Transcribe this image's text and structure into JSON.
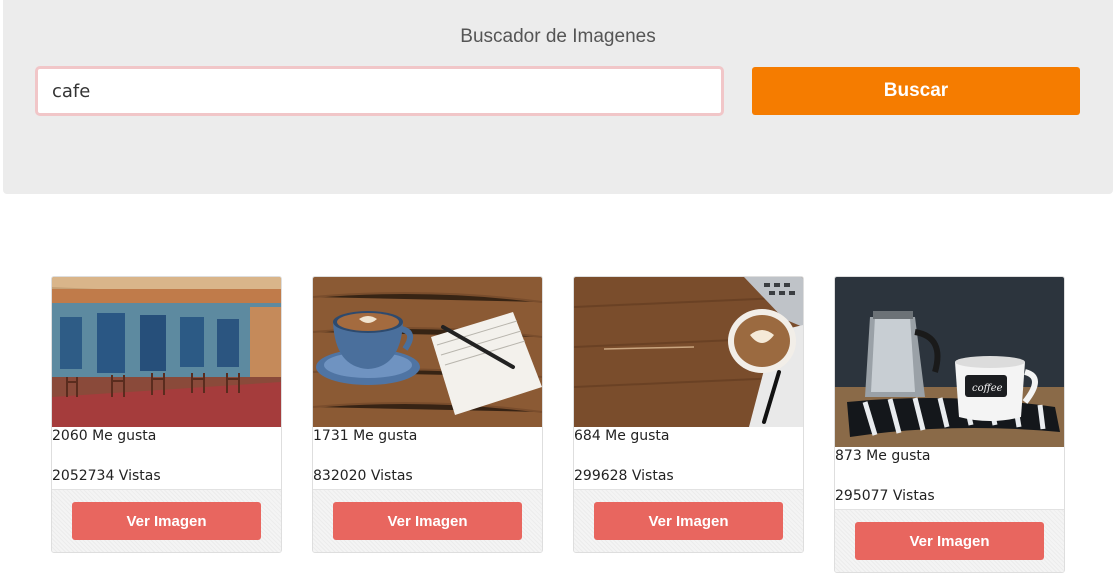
{
  "header": {
    "title": "Buscador de Imagenes",
    "search_value": "cafe",
    "search_button": "Buscar"
  },
  "results": [
    {
      "likes": "2060 Me gusta",
      "views": "2052734 Vistas",
      "button": "Ver Imagen",
      "image": "street-cafe-photo"
    },
    {
      "likes": "1731 Me gusta",
      "views": "832020 Vistas",
      "button": "Ver Imagen",
      "image": "coffee-cup-notebook-photo"
    },
    {
      "likes": "684 Me gusta",
      "views": "299628 Vistas",
      "button": "Ver Imagen",
      "image": "latte-laptop-photo"
    },
    {
      "likes": "873 Me gusta",
      "views": "295077 Vistas",
      "button": "Ver Imagen",
      "image": "coffee-mug-moka-pot-photo"
    }
  ],
  "colors": {
    "search_button": "#f57c00",
    "view_button": "#e8665f",
    "header_bg": "#ececec"
  }
}
